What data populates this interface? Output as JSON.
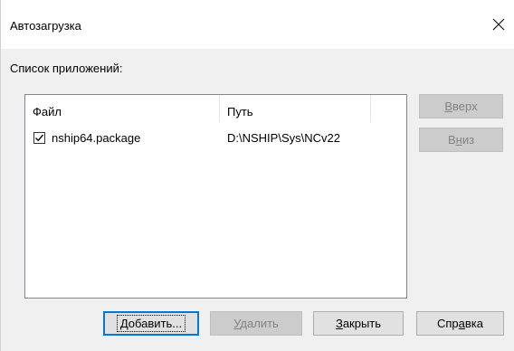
{
  "window": {
    "title": "Автозагрузка",
    "close_symbol": "close-icon"
  },
  "labels": {
    "app_list": "Список приложений:"
  },
  "listview": {
    "columns": [
      "Файл",
      "Путь"
    ],
    "rows": [
      {
        "checked": true,
        "file": "nship64.package",
        "path": "D:\\NSHIP\\Sys\\NCv22"
      }
    ]
  },
  "buttons": {
    "up": {
      "pre": "",
      "mnemonic": "В",
      "post": "верх",
      "enabled": false
    },
    "down": {
      "pre": "В",
      "mnemonic": "н",
      "post": "из",
      "enabled": false
    },
    "add": {
      "pre": "",
      "mnemonic": "Д",
      "post": "обавить...",
      "enabled": true,
      "default": true
    },
    "delete": {
      "pre": "",
      "mnemonic": "У",
      "post": "далить",
      "enabled": false
    },
    "close": {
      "pre": "",
      "mnemonic": "З",
      "post": "акрыть",
      "enabled": true
    },
    "help": {
      "pre": "Спр",
      "mnemonic": "а",
      "post": "вка",
      "enabled": true
    }
  },
  "colors": {
    "dialog_bg": "#f0f0f0",
    "disabled_text": "#838383",
    "default_border": "#0078d7"
  }
}
